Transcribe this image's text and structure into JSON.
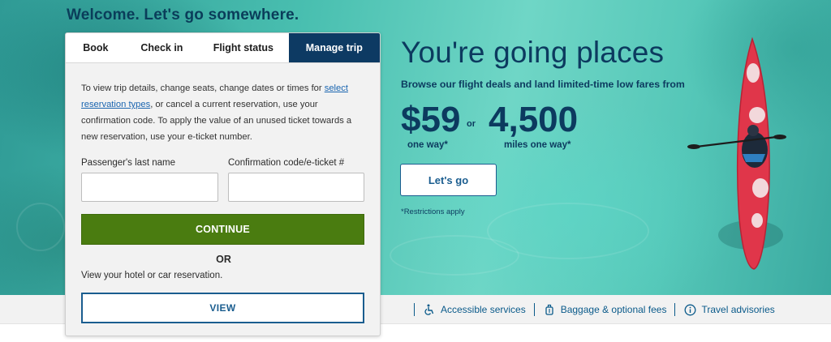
{
  "header": {
    "welcome": "Welcome. Let's go somewhere."
  },
  "booking": {
    "tabs": [
      {
        "label": "Book",
        "active": false
      },
      {
        "label": "Check in",
        "active": false
      },
      {
        "label": "Flight status",
        "active": false
      },
      {
        "label": "Manage trip",
        "active": true
      }
    ],
    "info_before_link": "To view trip details, change seats, change dates or times for ",
    "info_link": "select reservation types",
    "info_after_link": ", or cancel a current reservation, use your confirmation code. To apply the value of an unused ticket towards a new reservation, use your e-ticket number.",
    "last_name_label": "Passenger's last name",
    "last_name_value": "",
    "confirmation_label": "Confirmation code/e-ticket #",
    "confirmation_value": "",
    "continue_label": "CONTINUE",
    "or_label": "OR",
    "hotel_text": "View your hotel or car reservation.",
    "view_label": "VIEW"
  },
  "promo": {
    "title": "You're going places",
    "subtitle": "Browse our flight deals and land limited-time low fares from",
    "price": "$59",
    "price_unit": "one way*",
    "or": "or",
    "miles": "4,500",
    "miles_unit": "miles one way*",
    "cta_label": "Let's go",
    "restrictions": "*Restrictions apply"
  },
  "quick_links": [
    {
      "label": "Accessible services",
      "icon": "accessibility-icon"
    },
    {
      "label": "Baggage & optional fees",
      "icon": "luggage-icon"
    },
    {
      "label": "Travel advisories",
      "icon": "info-icon"
    }
  ],
  "colors": {
    "brand_navy": "#0d3a63",
    "continue_green": "#4a7c10",
    "link_blue": "#1a65b0",
    "kayak_red": "#e0364a"
  }
}
